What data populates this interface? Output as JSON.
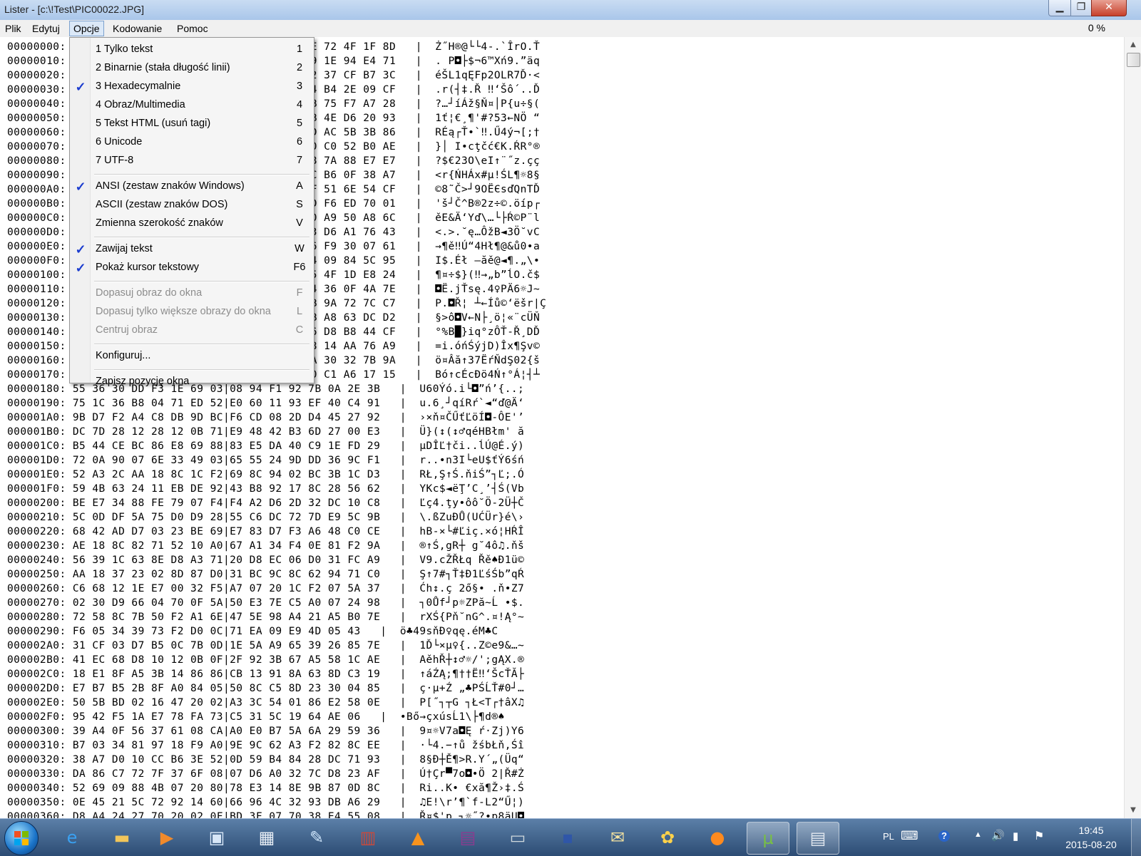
{
  "window": {
    "title": "Lister - [c:\\!Test\\PIC00022.JPG]",
    "minimize": "▁",
    "maximize": "❐",
    "close": "✕"
  },
  "menubar": {
    "items": [
      "Plik",
      "Edytuj",
      "Opcje",
      "Kodowanie",
      "Pomoc"
    ],
    "active": "Opcje",
    "percent": "0 %"
  },
  "dropdown": {
    "groups": [
      [
        {
          "label": "1  Tylko tekst",
          "key": "1",
          "checked": false,
          "disabled": false
        },
        {
          "label": "2  Binarnie (stała długość linii)",
          "key": "2",
          "checked": false,
          "disabled": false
        },
        {
          "label": "3  Hexadecymalnie",
          "key": "3",
          "checked": true,
          "disabled": false
        },
        {
          "label": "4  Obraz/Multimedia",
          "key": "4",
          "checked": false,
          "disabled": false
        },
        {
          "label": "5  Tekst HTML (usuń tagi)",
          "key": "5",
          "checked": false,
          "disabled": false
        },
        {
          "label": "6  Unicode",
          "key": "6",
          "checked": false,
          "disabled": false
        },
        {
          "label": "7  UTF-8",
          "key": "7",
          "checked": false,
          "disabled": false
        }
      ],
      [
        {
          "label": "ANSI (zestaw znaków Windows)",
          "key": "A",
          "checked": true,
          "disabled": false
        },
        {
          "label": "ASCII (zestaw znaków DOS)",
          "key": "S",
          "checked": false,
          "disabled": false
        },
        {
          "label": "Zmienna szerokość znaków",
          "key": "V",
          "checked": false,
          "disabled": false
        }
      ],
      [
        {
          "label": "Zawijaj tekst",
          "key": "W",
          "checked": true,
          "disabled": false
        },
        {
          "label": "Pokaż kursor tekstowy",
          "key": "F6",
          "checked": true,
          "disabled": false
        }
      ],
      [
        {
          "label": "Dopasuj obraz do okna",
          "key": "F",
          "checked": false,
          "disabled": true
        },
        {
          "label": "Dopasuj tylko większe obrazy do okna",
          "key": "L",
          "checked": false,
          "disabled": true
        },
        {
          "label": "Centruj obraz",
          "key": "C",
          "checked": false,
          "disabled": true
        }
      ],
      [
        {
          "label": "Konfiguruj...",
          "key": "",
          "checked": false,
          "disabled": false
        }
      ],
      [
        {
          "label": "Zapisz pozycję okna",
          "key": "",
          "checked": false,
          "disabled": false
        }
      ]
    ]
  },
  "hex_lines": [
    {
      "offset": "00000000:",
      "visible_tail": "CE 72 4F 1F 8D",
      "ascii": "Ż˝H®@└└4-.`ÎrO.Ť"
    },
    {
      "offset": "00000010:",
      "visible_tail": "39 1E 94 E4 71",
      "ascii": ". P◘├$¬6™Xń9.”äq"
    },
    {
      "offset": "00000020:",
      "visible_tail": "52 37 CF B7 3C",
      "ascii": "éŠL1qĘFp2OLR7Ď·<"
    },
    {
      "offset": "00000030:",
      "visible_tail": "D4 B4 2E 09 CF",
      "ascii": ".r(┤‡.Ř ‼‘Šô´..Ď"
    },
    {
      "offset": "00000040:",
      "visible_tail": "7B 75 F7 A7 28",
      "ascii": "?…┘íÁž§Ň¤│P{u÷§("
    },
    {
      "offset": "00000050:",
      "visible_tail": "1B 4E D6 20 93",
      "ascii": "1ť¦€¸¶'#?53←NÖ “"
    },
    {
      "offset": "00000060:",
      "visible_tail": "FD AC 5B 3B 86",
      "ascii": "RÉą┌Ť•`‼.Ű4ý¬[;†"
    },
    {
      "offset": "00000070:",
      "visible_tail": "90 C0 52 B0 AE",
      "ascii": "}│ I•cţčć€K.ŔR°®"
    },
    {
      "offset": "00000080:",
      "visible_tail": "A8 7A 88 E7 E7",
      "ascii": "?$€23O\\eI↑¨˝z.çç"
    },
    {
      "offset": "00000090:",
      "visible_tail": "4C B6 0F 38 A7",
      "ascii": "<r{ŃHÁx#µ!ŚL¶☼8§"
    },
    {
      "offset": "000000A0:",
      "visible_tail": "EF 51 6E 54 CF",
      "ascii": "©8˜Č>┘9OËЄsďQnTĎ"
    },
    {
      "offset": "000000B0:",
      "visible_tail": "1D F6 ED 70 01",
      "ascii": "'š┘Č^B®2z÷©.öíp┌"
    },
    {
      "offset": "000000C0:",
      "visible_tail": "C0 A9 50 A8 6C",
      "ascii": "ěE&Ä‘Yď\\…└├Ŕ©P¨l"
    },
    {
      "offset": "000000D0:",
      "visible_tail": "33 D6 A1 76 43",
      "ascii": "<.>.˘ę…ÔžB◄3Ö˘vC"
    },
    {
      "offset": "000000E0:",
      "visible_tail": "26 F9 30 07 61",
      "ascii": "→¶ě‼Ú“4Hł¶@&ů0•a"
    },
    {
      "offset": "000000F0:",
      "visible_tail": "14 09 84 5C 95",
      "ascii": "I$.Éł —ăě@◄¶.„\\•"
    },
    {
      "offset": "00000100:",
      "visible_tail": "E5 4F 1D E8 24",
      "ascii": "¶¤÷$}(‼→„b”ĺO.č$"
    },
    {
      "offset": "00000110:",
      "visible_tail": "C4 36 0F 4A 7E",
      "ascii": "◘Ë.jŤsę.4♀PÄ6☼J~"
    },
    {
      "offset": "00000120:",
      "visible_tail": "EB 9A 72 7C C7",
      "ascii": "P.◘Ř¦ ┴←Íů©‘ëšr|Ç"
    },
    {
      "offset": "00000130:",
      "visible_tail": "AB A8 63 DC D2",
      "ascii": "§>ô◘V←N├¸ö¦«¨cÜŇ"
    },
    {
      "offset": "00000140:",
      "visible_tail": "96 D8 B8 44 CF",
      "ascii": "°%B█}iq°zÔŤ-Ř¸DĎ"
    },
    {
      "offset": "00000150:",
      "visible_tail": "78 14 AA 76 A9",
      "ascii": "=i.óńŚýjD)Îx¶Şv©"
    },
    {
      "offset": "00000160:",
      "visible_tail": "AA 30 32 7B 9A",
      "ascii": "ö¤Âă↑37ËŕŇdŞ02{š"
    },
    {
      "offset": "00000170:",
      "visible_tail": "B0 C1 A6 17 15",
      "ascii": "Bó↑cÉcĐö4Ń↑°Á¦┤┴"
    },
    {
      "offset": "00000180:",
      "visible_tail": "55 36 30 DD F3 1E 69 03|08 94 F1 92 7B 0A 2E 3B",
      "ascii": "U60Ýó.i└◘”ń’{..;"
    },
    {
      "offset": "00000190:",
      "visible_tail": "75 1C 36 B8 04 71 ED 52|E0 60 11 93 EF 40 C4 91",
      "ascii": "u.6¸┘qíRŕ`◄“ď@Ä‘"
    },
    {
      "offset": "000001A0:",
      "visible_tail": "9B D7 F2 A4 C8 DB 9D BC|F6 CD 08 2D D4 45 27 92",
      "ascii": "›×ň¤ČŰťĽöÍ◘-ÔE'’"
    },
    {
      "offset": "000001B0:",
      "visible_tail": "DC 7D 28 12 28 12 0B 71|E9 48 42 B3 6D 27 00 E3",
      "ascii": "Ü}(↕(↕♂qéHBłm' ă"
    },
    {
      "offset": "000001C0:",
      "visible_tail": "B5 44 CE BC 86 E8 69 88|83 E5 DA 40 C9 1E FD 29",
      "ascii": "µDÎĽ†či..ĺÚ@É.ý)"
    },
    {
      "offset": "000001D0:",
      "visible_tail": "72 0A 90 07 6E 33 49 03|65 55 24 9D DD 36 9C F1",
      "ascii": "r..•n3I└eU$ťÝ6śń"
    },
    {
      "offset": "000001E0:",
      "visible_tail": "52 A3 2C AA 18 8C 1C F2|69 8C 94 02 BC 3B 1C D3",
      "ascii": "RŁ,Ş↑Ś.ňiŚ”┐Ľ;.Ó"
    },
    {
      "offset": "000001F0:",
      "visible_tail": "59 4B 63 24 11 EB DE 92|43 B8 92 17 8C 28 56 62",
      "ascii": "YKc$◄ëŢ’C¸’┤Ś(Vb"
    },
    {
      "offset": "00000200:",
      "visible_tail": "BE E7 34 88 FE 79 07 F4|F4 A2 D6 2D 32 DC 10 C8",
      "ascii": "Ľç4.ţy•ôô˘Ö-2Ü┼Č"
    },
    {
      "offset": "00000210:",
      "visible_tail": "5C 0D DF 5A 75 D0 D9 28|55 C6 DC 72 7D E9 5C 9B",
      "ascii": "\\.ßZuĐŮ(UĆÜr}é\\›"
    },
    {
      "offset": "00000220:",
      "visible_tail": "68 42 AD D7 03 23 BE 69|E7 83 D7 F3 A6 48 C0 CE",
      "ascii": "hB-×└#Ľiç.×ó¦HŔÎ"
    },
    {
      "offset": "00000230:",
      "visible_tail": "AE 18 8C 82 71 52 10 A0|67 A1 34 F4 0E 81 F2 9A",
      "ascii": "®↑Ś‚gR┼ g˘4ô♫.ňš"
    },
    {
      "offset": "00000240:",
      "visible_tail": "56 39 1C 63 8E D8 A3 71|20 D8 EC 06 D0 31 FC A9",
      "ascii": "V9.cŽŘŁq Řě♠Đ1ü©"
    },
    {
      "offset": "00000250:",
      "visible_tail": "AA 18 37 23 02 8D 87 D0|31 BC 9C 8C 62 94 71 C0",
      "ascii": "Ş↑7#┐Ť‡Đ1ĽśŚb”qŔ"
    },
    {
      "offset": "00000260:",
      "visible_tail": "C6 68 12 1E E7 00 32 F5|A7 07 20 1C F2 07 5A 37",
      "ascii": "Ćh↕.ç 2ő§• .ň•Z7"
    },
    {
      "offset": "00000270:",
      "visible_tail": "02 30 D9 66 04 70 0F 5A|50 E3 7E C5 A0 07 24 98",
      "ascii": "┐0Ůf┘p☼ZPă~Ĺ •$."
    },
    {
      "offset": "00000280:",
      "visible_tail": "72 58 8C 7B 50 F2 A1 6E|47 5E 98 A4 21 A5 B0 7E",
      "ascii": "rXŚ{Pň˘nG^.¤!Ą°~"
    },
    {
      "offset": "00000290:",
      "visible_tail": "F6 05 34 39 73 F2 D0 0C|71 EA 09 E9 4D 05 43",
      "ascii": "ö♣49sňĐ♀qę.éM♣C"
    },
    {
      "offset": "000002A0:",
      "visible_tail": "31 CF 03 D7 B5 0C 7B 0D|1E 5A A9 65 39 26 85 7E",
      "ascii": "1Ď└×µ♀{..Z©e9&…~"
    },
    {
      "offset": "000002B0:",
      "visible_tail": "41 EC 68 D8 10 12 0B 0F|2F 92 3B 67 A5 58 1C AE",
      "ascii": "AěhŘ┼↕♂☼/';gĄX.®"
    },
    {
      "offset": "000002C0:",
      "visible_tail": "18 E1 8F A5 3B 14 86 86|CB 13 91 8A 63 8D C3 19",
      "ascii": "↑áŹĄ;¶††Ë‼‘ŠcŤĂ├"
    },
    {
      "offset": "000002D0:",
      "visible_tail": "E7 B7 B5 2B 8F A0 84 05|50 8C C5 8D 23 30 04 85",
      "ascii": "ç·µ+Ź „♣PŚĹŤ#0┘…"
    },
    {
      "offset": "000002E0:",
      "visible_tail": "50 5B BD 02 16 47 20 02|A3 3C 54 01 86 E2 58 0E",
      "ascii": "P[˝┐┬G ┐Ł<T┌†âX♫"
    },
    {
      "offset": "000002F0:",
      "visible_tail": "95 42 F5 1A E7 78 FA 73|C5 31 5C 19 64 AE 06",
      "ascii": "•Bő→çxúsĹ1\\├¶d®♠"
    },
    {
      "offset": "00000300:",
      "visible_tail": "39 A4 0F 56 37 61 08 CA|A0 E0 B7 5A 6A 29 59 36",
      "ascii": "9¤☼V7a◘Ę ŕ·Zj)Y6"
    },
    {
      "offset": "00000310:",
      "visible_tail": "B7 03 34 81 97 18 F9 A0|9E 9C 62 A3 F2 82 8C EE",
      "ascii": "·└4.−↑ů žśbŁň‚Śî"
    },
    {
      "offset": "00000320:",
      "visible_tail": "38 A7 D0 10 CC B6 3E 52|0D 59 B4 84 28 DC 71 93",
      "ascii": "8§Đ┼Ě¶>R.Y´„(Üq“"
    },
    {
      "offset": "00000330:",
      "visible_tail": "DA 86 C7 72 7F 37 6F 08|07 D6 A0 32 7C D8 23 AF",
      "ascii": "Ú†Çr▀7o◘•Ö 2|Ř#Ż"
    },
    {
      "offset": "00000340:",
      "visible_tail": "52 69 09 88 4B 07 20 80|78 E3 14 8E 9B 87 0D 8C",
      "ascii": "Ri..K• €xă¶Ž›‡.Ś"
    },
    {
      "offset": "00000350:",
      "visible_tail": "0E 45 21 5C 72 92 14 60|66 96 4C 32 93 DB A6 29",
      "ascii": "♫E!\\r’¶`f-L2“Ű¦)"
    },
    {
      "offset": "00000360:",
      "visible_tail": "D8 A4 24 27 70 20 02 0F|BD 3F 07 70 38 E4 55 08",
      "ascii": "Ř¤$'p ┐☼˝?•p8äU◘"
    }
  ],
  "taskbar": {
    "icons": [
      {
        "name": "ie-icon",
        "glyph": "e",
        "color": "#3aa0f0",
        "active": false
      },
      {
        "name": "explorer-folder-icon",
        "glyph": "▬",
        "color": "#f1c55a",
        "active": false
      },
      {
        "name": "media-player-icon",
        "glyph": "▶",
        "color": "#f08a2c",
        "active": false
      },
      {
        "name": "remote-desktop-icon",
        "glyph": "▣",
        "color": "#d7e6f7",
        "active": false
      },
      {
        "name": "calculator-icon",
        "glyph": "▦",
        "color": "#e8eef5",
        "active": false
      },
      {
        "name": "notepad-icon",
        "glyph": "✎",
        "color": "#cfe6fb",
        "active": false
      },
      {
        "name": "winrar-books-icon",
        "glyph": "▥",
        "color": "#c94a3c",
        "active": false
      },
      {
        "name": "vlc-cone-icon",
        "glyph": "▲",
        "color": "#f7931e",
        "active": false
      },
      {
        "name": "archive-icon",
        "glyph": "▤",
        "color": "#8b3b8f",
        "active": false
      },
      {
        "name": "console-icon",
        "glyph": "▭",
        "color": "#cfd8dc",
        "active": false
      },
      {
        "name": "floppy-save-icon",
        "glyph": "▪",
        "color": "#2f56a8",
        "active": false
      },
      {
        "name": "mail-icon",
        "glyph": "✉",
        "color": "#f4e2a0",
        "active": false
      },
      {
        "name": "paint-icon",
        "glyph": "✿",
        "color": "#ffd24a",
        "active": false
      },
      {
        "name": "firefox-icon",
        "glyph": "●",
        "color": "#ff8a1e",
        "active": false
      },
      {
        "name": "utorrent-icon",
        "glyph": "µ",
        "color": "#78c043",
        "active": true
      },
      {
        "name": "lister-app-icon",
        "glyph": "▤",
        "color": "#e0e6ee",
        "active": true
      }
    ],
    "tray": {
      "language": "PL",
      "keyboard": "⌨",
      "help": "?",
      "expand": "▲",
      "volume": "🔊",
      "network": "▮",
      "flag": "⚑"
    },
    "time": "19:45",
    "date": "2015-08-20"
  }
}
